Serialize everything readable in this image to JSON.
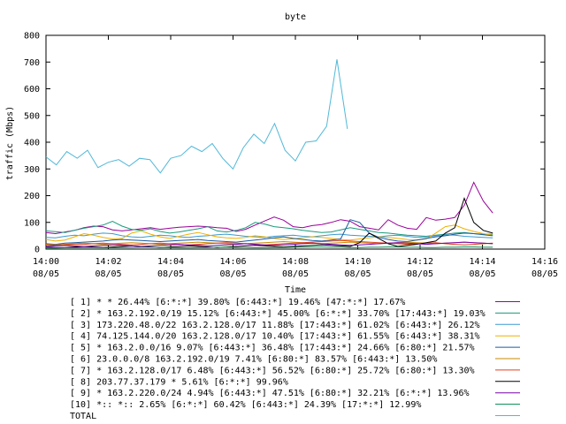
{
  "chart_data": {
    "type": "line",
    "title": "byte",
    "xlabel": "Time",
    "ylabel": "traffic (Mbps)",
    "ylim": [
      0,
      800
    ],
    "yticks": [
      0,
      100,
      200,
      300,
      400,
      500,
      600,
      700,
      800
    ],
    "xlim_minutes": [
      0,
      16
    ],
    "xticks": [
      {
        "minute": 0,
        "time": "14:00",
        "date": "08/05"
      },
      {
        "minute": 2,
        "time": "14:02",
        "date": "08/05"
      },
      {
        "minute": 4,
        "time": "14:04",
        "date": "08/05"
      },
      {
        "minute": 6,
        "time": "14:06",
        "date": "08/05"
      },
      {
        "minute": 8,
        "time": "14:08",
        "date": "08/05"
      },
      {
        "minute": 10,
        "time": "14:10",
        "date": "08/05"
      },
      {
        "minute": 12,
        "time": "14:12",
        "date": "08/05"
      },
      {
        "minute": 14,
        "time": "14:14",
        "date": "08/05"
      },
      {
        "minute": 16,
        "time": "14:16",
        "date": "08/05"
      }
    ],
    "x_minutes": [
      0,
      0.333,
      0.667,
      1.0,
      1.333,
      1.667,
      2.0,
      2.333,
      2.667,
      3.0,
      3.333,
      3.667,
      4.0,
      4.333,
      4.667,
      5.0,
      5.333,
      5.667,
      6.0,
      6.333,
      6.667,
      7.0,
      7.333,
      7.667,
      8.0,
      8.333,
      8.667,
      9.0,
      9.333,
      9.667,
      10.0,
      10.333,
      10.667,
      11.0,
      11.333,
      11.667,
      12.0,
      12.333,
      12.667,
      13.0,
      13.333,
      13.667,
      14.0,
      14.333
    ],
    "legend_position": "bottom",
    "series": [
      {
        "name": "[ 1] * * 26.44%  [6:*:*] 39.80% [6:443:*] 19.46% [47:*:*] 17.67%",
        "color": "#9a009a",
        "values": [
          62,
          58,
          64,
          70,
          80,
          86,
          84,
          72,
          68,
          72,
          76,
          80,
          74,
          78,
          82,
          84,
          86,
          84,
          80,
          78,
          66,
          74,
          90,
          105,
          120,
          108,
          84,
          80,
          88,
          92,
          100,
          110,
          104,
          84,
          78,
          72,
          110,
          90,
          78,
          74,
          118,
          108,
          112,
          118,
          164,
          250,
          180,
          135
        ]
      },
      {
        "name": "[ 2] * 163.2.192.0/19 15.12%  [6:443:*] 45.00% [6:*:*] 33.70% [17:443:*] 19.03%",
        "color": "#1a9a7a",
        "values": [
          68,
          65,
          62,
          70,
          78,
          84,
          90,
          104,
          86,
          74,
          70,
          76,
          66,
          60,
          64,
          70,
          76,
          84,
          68,
          64,
          70,
          80,
          100,
          94,
          84,
          80,
          76,
          70,
          66,
          62,
          64,
          72,
          80,
          74,
          68,
          62,
          60,
          56,
          52,
          50,
          48,
          52,
          56,
          60,
          62,
          58,
          56,
          56
        ]
      },
      {
        "name": "[ 3] 173.220.48.0/22 163.2.128.0/17 11.88%  [17:443:*] 61.02% [6:443:*] 26.12%",
        "color": "#3a9ad0",
        "values": [
          44,
          42,
          48,
          52,
          50,
          56,
          60,
          58,
          50,
          46,
          44,
          48,
          52,
          50,
          46,
          44,
          48,
          50,
          54,
          56,
          52,
          48,
          46,
          44,
          48,
          50,
          52,
          48,
          46,
          50,
          54,
          56,
          52,
          50,
          48,
          46,
          50,
          52,
          48,
          44,
          46,
          50,
          54,
          52,
          48,
          46,
          44,
          42
        ]
      },
      {
        "name": "[ 4] 74.125.144.0/20 163.2.128.0/17 10.40%  [17:443:*] 61.55% [6:443:*] 38.31%",
        "color": "#f0b000",
        "values": [
          36,
          30,
          34,
          46,
          58,
          52,
          44,
          38,
          40,
          60,
          68,
          56,
          46,
          40,
          48,
          56,
          62,
          54,
          46,
          42,
          40,
          44,
          50,
          46,
          40,
          36,
          38,
          42,
          46,
          44,
          40,
          36,
          34,
          38,
          42,
          46,
          44,
          40,
          36,
          34,
          38,
          60,
          84,
          90,
          76,
          66,
          58,
          52
        ]
      },
      {
        "name": "[ 5] * 163.2.0.0/16 9.07%  [6:443:*] 36.48% [17:443:*] 24.66% [6:80:*] 21.57%",
        "color": "#1a5aa0",
        "values": [
          20,
          18,
          22,
          24,
          26,
          28,
          30,
          34,
          36,
          34,
          32,
          30,
          28,
          30,
          32,
          34,
          36,
          32,
          30,
          28,
          26,
          30,
          34,
          38,
          42,
          46,
          40,
          36,
          32,
          30,
          34,
          38,
          110,
          100,
          60,
          44,
          36,
          30,
          28,
          34,
          40,
          46,
          50,
          56,
          60,
          58,
          54,
          50
        ]
      },
      {
        "name": "[ 6] 23.0.0.0/8 163.2.192.0/19 7.41%  [6:80:*] 83.57% [6:443:*] 13.50%",
        "color": "#c88a00",
        "values": [
          18,
          16,
          18,
          20,
          22,
          20,
          18,
          20,
          22,
          24,
          22,
          20,
          18,
          20,
          22,
          24,
          26,
          24,
          22,
          20,
          18,
          20,
          22,
          24,
          26,
          28,
          26,
          24,
          22,
          20,
          22,
          24,
          26,
          24,
          22,
          20,
          22,
          24,
          26,
          24,
          22,
          20,
          22,
          24,
          26,
          24,
          22,
          20
        ]
      },
      {
        "name": "[ 7] * 163.2.128.0/17 6.48%  [6:443:*] 56.52% [6:80:*] 25.72% [6:80:*] 13.30%",
        "color": "#e04020",
        "values": [
          16,
          14,
          16,
          18,
          18,
          20,
          22,
          20,
          18,
          16,
          18,
          20,
          22,
          20,
          18,
          16,
          18,
          20,
          22,
          24,
          22,
          20,
          18,
          16,
          18,
          20,
          22,
          24,
          26,
          28,
          30,
          32,
          30,
          28,
          26,
          24,
          22,
          20,
          18,
          20,
          22,
          24,
          20,
          18,
          16,
          18,
          20,
          22
        ]
      },
      {
        "name": "[ 8] 203.77.37.179 * 5.61%  [6:*:*] 99.96%",
        "color": "#000000",
        "values": [
          8,
          6,
          6,
          8,
          10,
          8,
          6,
          8,
          10,
          12,
          10,
          8,
          6,
          8,
          10,
          12,
          10,
          8,
          6,
          8,
          10,
          12,
          14,
          12,
          10,
          8,
          10,
          12,
          14,
          16,
          14,
          12,
          10,
          24,
          60,
          40,
          20,
          10,
          14,
          18,
          24,
          30,
          60,
          80,
          190,
          100,
          70,
          60
        ]
      },
      {
        "name": "[ 9] * 163.2.220.0/24 4.94%  [6:443:*] 47.51% [6:80:*] 32.21% [6:*:*] 13.96%",
        "color": "#7a00aa",
        "values": [
          10,
          12,
          14,
          12,
          10,
          12,
          14,
          16,
          14,
          12,
          10,
          12,
          14,
          16,
          18,
          16,
          14,
          12,
          14,
          16,
          18,
          20,
          18,
          16,
          14,
          16,
          18,
          20,
          22,
          20,
          18,
          16,
          14,
          16,
          18,
          20,
          22,
          24,
          22,
          20,
          18,
          20,
          22,
          24,
          26,
          24,
          22,
          20
        ]
      },
      {
        "name": "[10] *:: *:: 2.65%  [6:*:*] 60.42% [6:443:*] 24.39% [17:*:*] 12.99%",
        "color": "#008a50",
        "values": [
          4,
          4,
          5,
          5,
          6,
          6,
          5,
          5,
          6,
          6,
          7,
          7,
          6,
          6,
          5,
          5,
          6,
          6,
          7,
          7,
          6,
          6,
          5,
          5,
          6,
          6,
          7,
          7,
          8,
          8,
          7,
          7,
          6,
          6,
          7,
          7,
          8,
          8,
          7,
          7,
          6,
          6,
          7,
          7,
          8,
          8,
          7,
          7
        ]
      },
      {
        "name": "TOTAL",
        "color": "#50b8d8",
        "values": [
          345,
          315,
          365,
          340,
          370,
          305,
          325,
          335,
          310,
          340,
          335,
          285,
          340,
          350,
          385,
          365,
          395,
          340,
          300,
          380,
          430,
          395,
          470,
          370,
          330,
          400,
          405,
          460,
          710,
          450
        ]
      }
    ]
  }
}
